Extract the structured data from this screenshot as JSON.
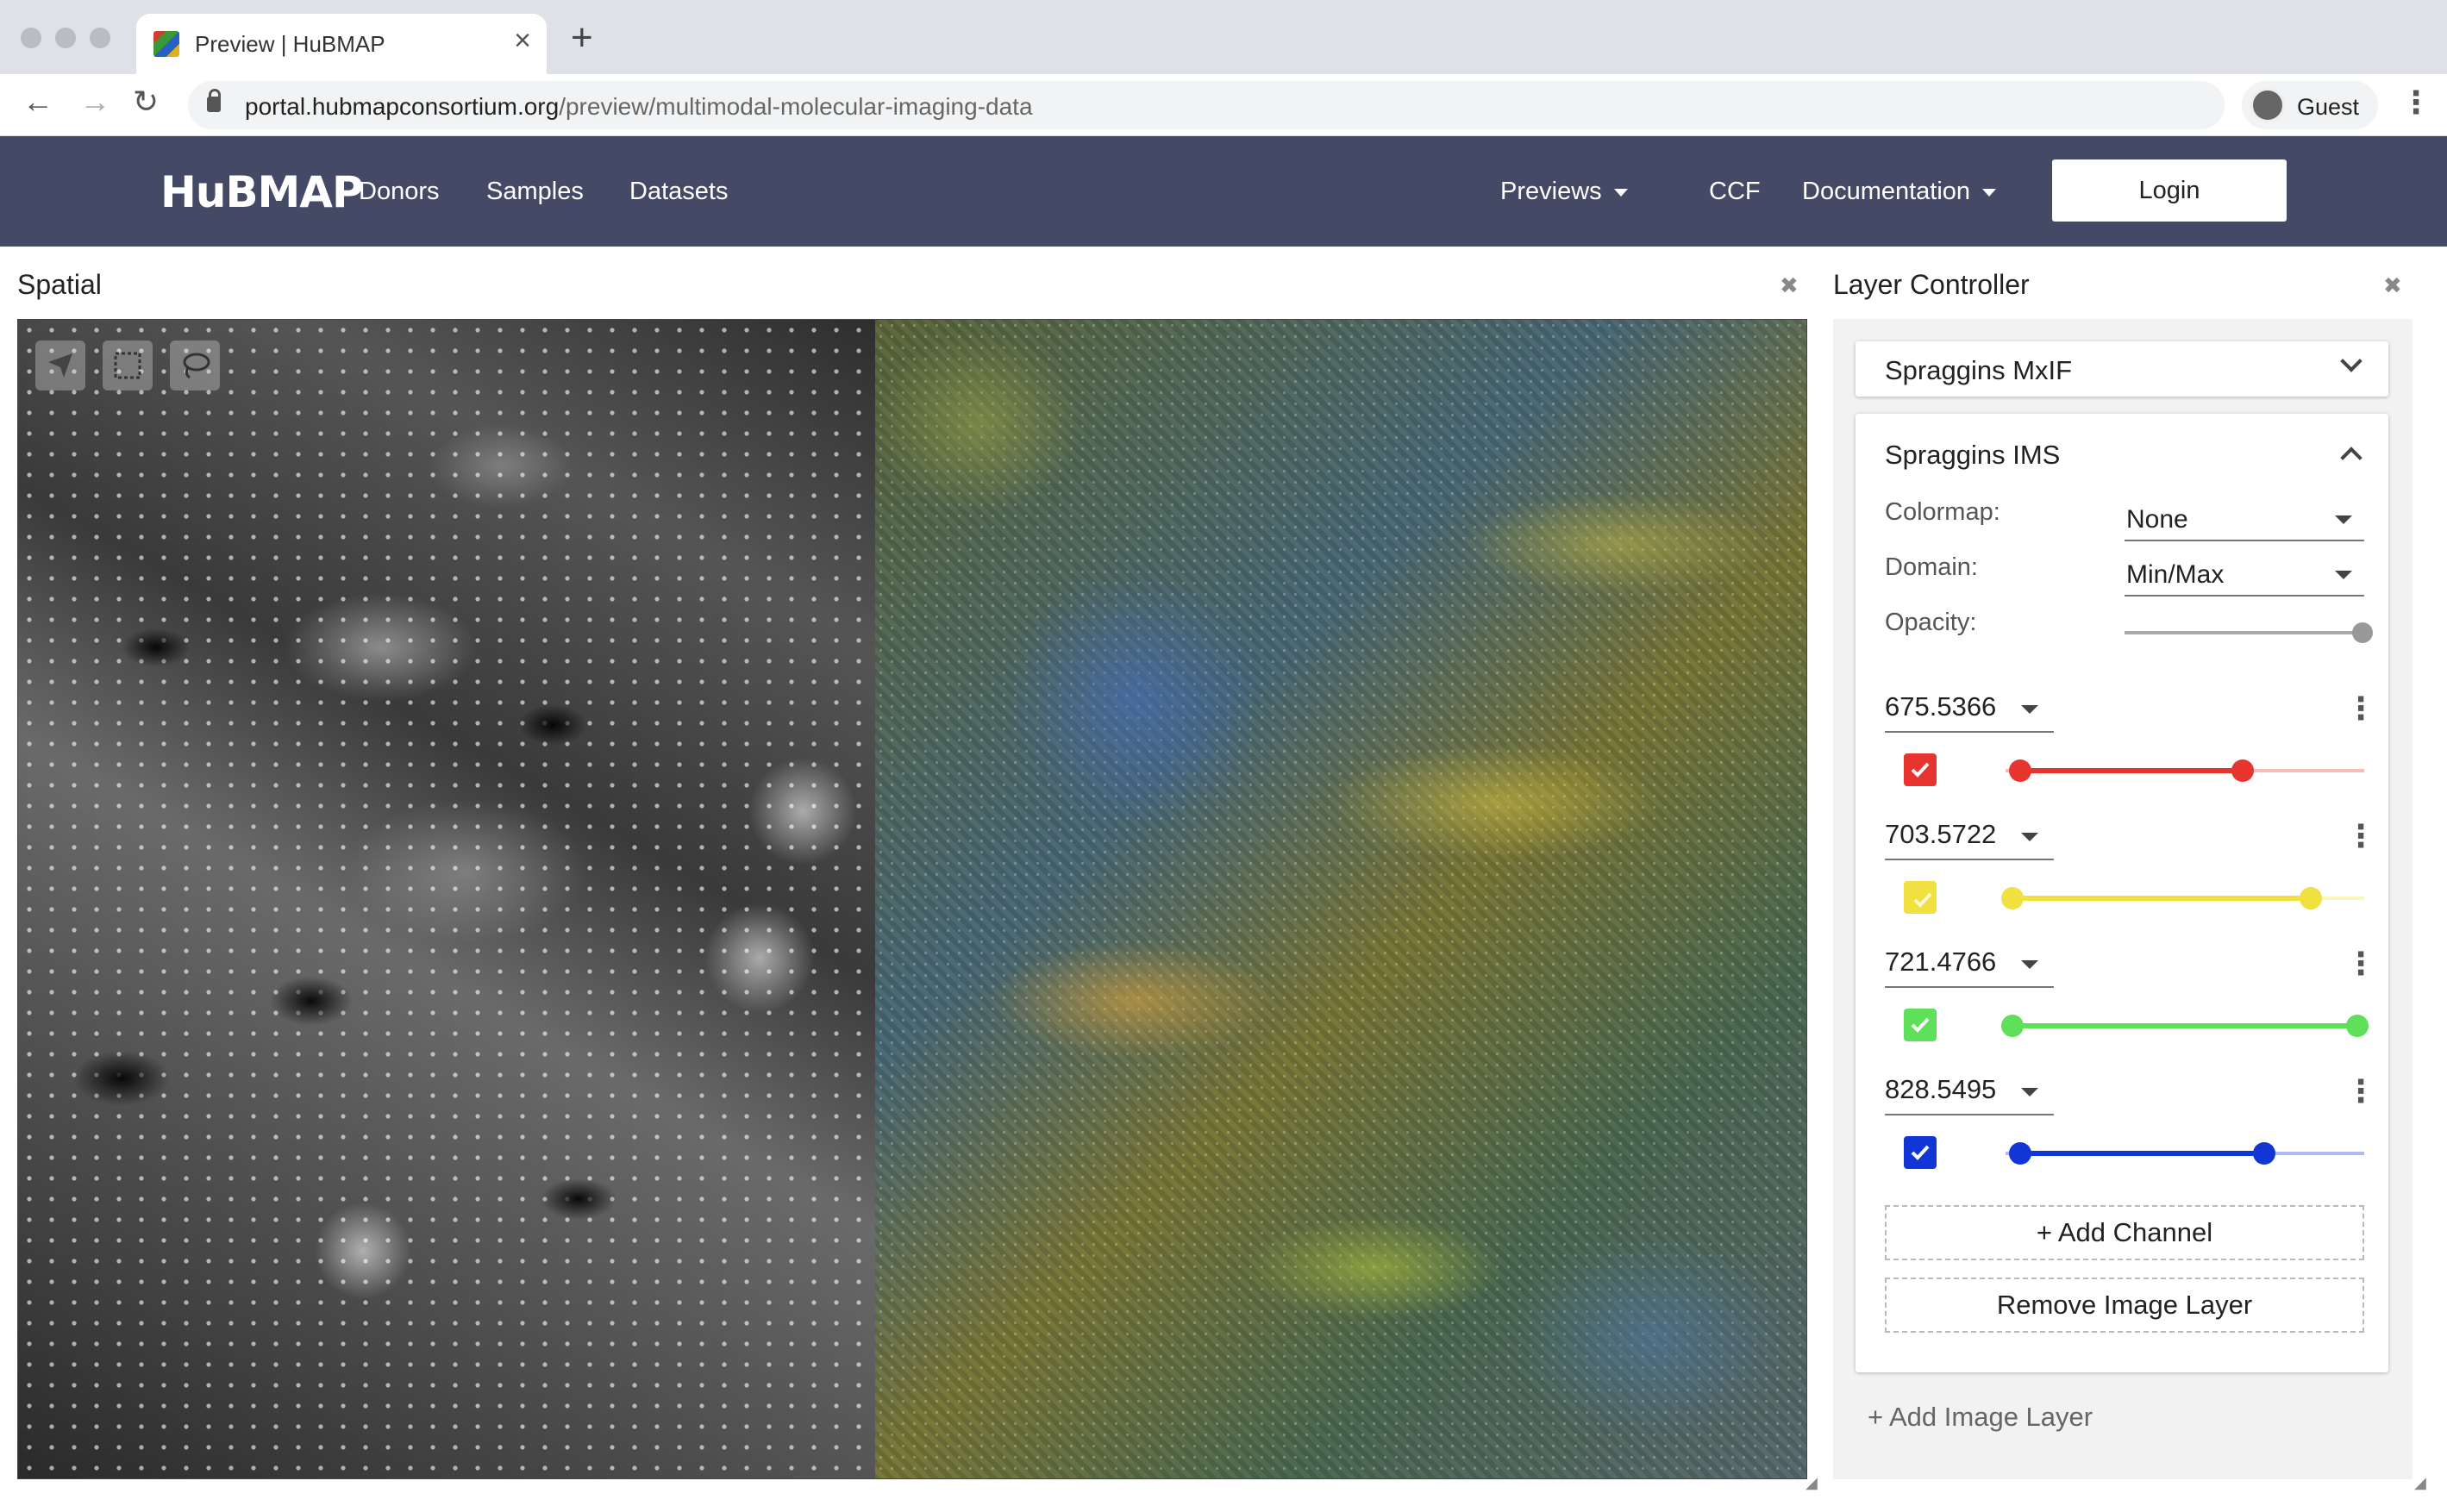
{
  "browser": {
    "tab_title": "Preview | HuBMAP",
    "tab_close": "×",
    "new_tab": "+",
    "url_host": "portal.hubmapconsortium.org",
    "url_path": "/preview/multimodal-molecular-imaging-data",
    "profile_label": "Guest",
    "back": "←",
    "forward": "→",
    "reload": "↻",
    "menu": "⋮"
  },
  "nav": {
    "logo": "HuBMAP",
    "links": [
      "Donors",
      "Samples",
      "Datasets"
    ],
    "previews": "Previews",
    "ccf": "CCF",
    "documentation": "Documentation",
    "login": "Login"
  },
  "spatial": {
    "title": "Spatial",
    "close": "✖"
  },
  "layer_controller": {
    "title": "Layer Controller",
    "close": "✖",
    "mxif_layer": "Spraggins MxIF",
    "ims_layer": {
      "name": "Spraggins IMS",
      "colormap_label": "Colormap:",
      "colormap_value": "None",
      "domain_label": "Domain:",
      "domain_value": "Min/Max",
      "opacity_label": "Opacity:",
      "opacity": 1.0,
      "channels": [
        {
          "value": "675.5366",
          "color": "#e8342f",
          "checked": true,
          "range": [
            0.04,
            0.66
          ]
        },
        {
          "value": "703.5722",
          "color": "#f0e040",
          "checked": false,
          "range": [
            0.02,
            0.85
          ]
        },
        {
          "value": "721.4766",
          "color": "#5fe05a",
          "checked": true,
          "range": [
            0.02,
            0.98
          ]
        },
        {
          "value": "828.5495",
          "color": "#1236d6",
          "checked": true,
          "range": [
            0.04,
            0.72
          ]
        }
      ],
      "add_channel": "+ Add Channel",
      "remove_layer": "Remove Image Layer"
    },
    "add_image_layer": "+ Add Image Layer"
  }
}
